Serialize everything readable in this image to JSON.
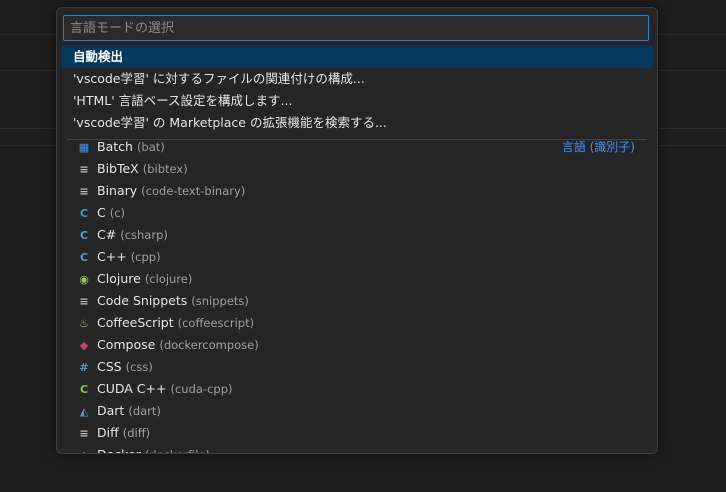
{
  "picker": {
    "placeholder": "言語モードの選択",
    "actions": [
      "自動検出",
      "'vscode学習' に対するファイルの関連付けの構成...",
      "'HTML' 言語ベース設定を構成します...",
      "'vscode学習' の Marketplace の拡張機能を検索する..."
    ],
    "group_label": "言語 (識別子)",
    "languages": [
      {
        "name": "Batch",
        "id": "(bat)",
        "icon": "windows-icon",
        "glyph": "▦",
        "color": "#3794ff"
      },
      {
        "name": "BibTeX",
        "id": "(bibtex)",
        "icon": "file-lines-icon",
        "glyph": "≡",
        "color": "#bdbdbd"
      },
      {
        "name": "Binary",
        "id": "(code-text-binary)",
        "icon": "file-lines-icon",
        "glyph": "≡",
        "color": "#bdbdbd"
      },
      {
        "name": "C",
        "id": "(c)",
        "icon": "c-icon",
        "glyph": "C",
        "color": "#3c9fd8"
      },
      {
        "name": "C#",
        "id": "(csharp)",
        "icon": "csharp-icon",
        "glyph": "C",
        "color": "#4f9dd9"
      },
      {
        "name": "C++",
        "id": "(cpp)",
        "icon": "cpp-icon",
        "glyph": "C",
        "color": "#4f9dd9"
      },
      {
        "name": "Clojure",
        "id": "(clojure)",
        "icon": "clojure-icon",
        "glyph": "◉",
        "color": "#8dc149"
      },
      {
        "name": "Code Snippets",
        "id": "(snippets)",
        "icon": "file-lines-icon",
        "glyph": "≡",
        "color": "#bdbdbd"
      },
      {
        "name": "CoffeeScript",
        "id": "(coffeescript)",
        "icon": "coffee-icon",
        "glyph": "♨",
        "color": "#cbcb41"
      },
      {
        "name": "Compose",
        "id": "(dockercompose)",
        "icon": "docker-icon",
        "glyph": "◆",
        "color": "#cc3e6b"
      },
      {
        "name": "CSS",
        "id": "(css)",
        "icon": "hash-icon",
        "glyph": "#",
        "color": "#519aba"
      },
      {
        "name": "CUDA C++",
        "id": "(cuda-cpp)",
        "icon": "cuda-icon",
        "glyph": "C",
        "color": "#8dc149"
      },
      {
        "name": "Dart",
        "id": "(dart)",
        "icon": "dart-icon",
        "glyph": "◭",
        "color": "#519aba"
      },
      {
        "name": "Diff",
        "id": "(diff)",
        "icon": "file-lines-icon",
        "glyph": "≡",
        "color": "#bdbdbd"
      },
      {
        "name": "Docker",
        "id": "(dockerfile)",
        "icon": "docker-icon",
        "glyph": "◆",
        "color": "#519aba"
      }
    ]
  }
}
